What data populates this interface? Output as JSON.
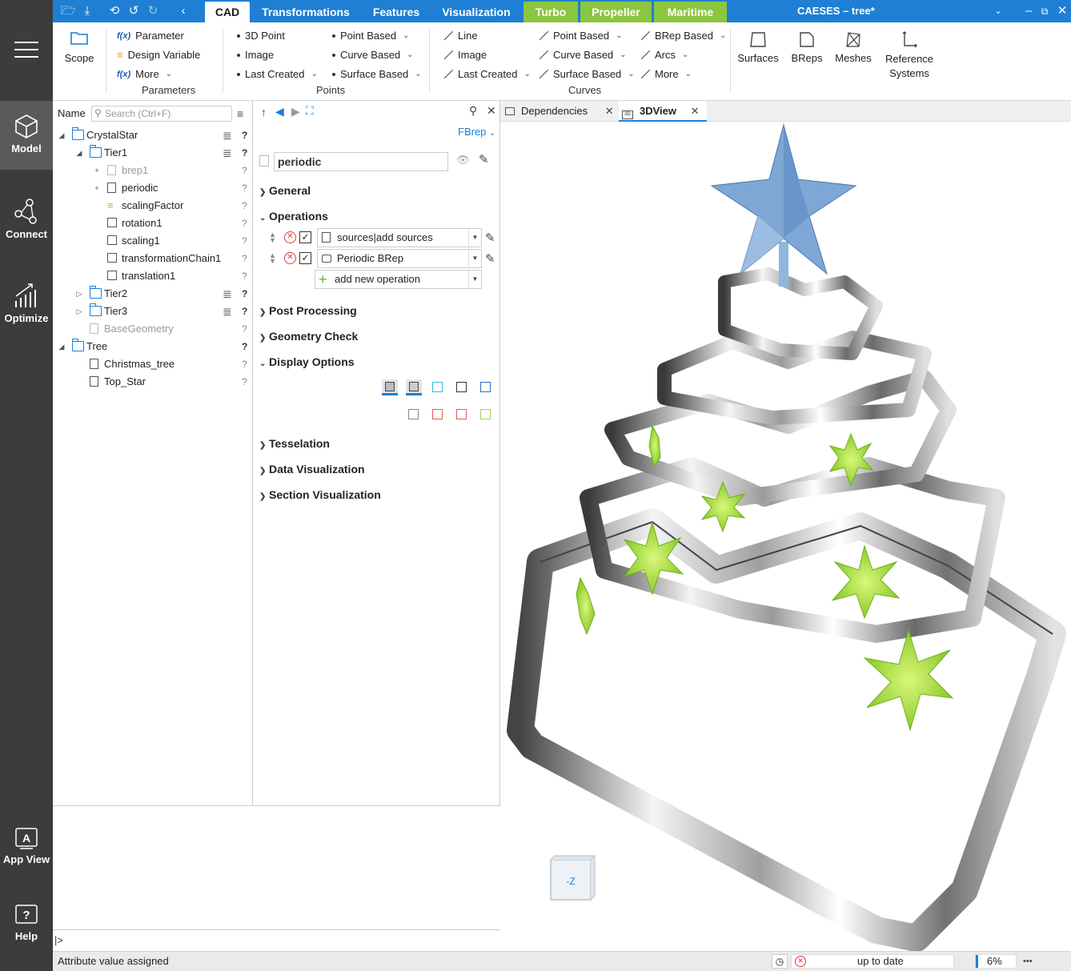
{
  "app": {
    "title": "CAESES  –  tree*",
    "accent": "#1e7fd4",
    "green": "#8cc63f"
  },
  "nav": [
    {
      "label": "Model",
      "icon": "cube-icon",
      "active": true
    },
    {
      "label": "Connect",
      "icon": "connect-icon"
    },
    {
      "label": "Optimize",
      "icon": "optimize-icon"
    },
    {
      "label": "App View",
      "icon": "app-view-icon"
    },
    {
      "label": "Help",
      "icon": "help-icon"
    }
  ],
  "tabs": {
    "items": [
      "CAD",
      "Transformations",
      "Features",
      "Visualization",
      "Turbo",
      "Propeller",
      "Maritime"
    ],
    "active": "CAD"
  },
  "ribbon": {
    "scope": "Scope",
    "parameters": {
      "items": [
        "Parameter",
        "Design Variable",
        "More"
      ],
      "label": "Parameters"
    },
    "points": {
      "col1": [
        "3D Point",
        "Image",
        "Last Created"
      ],
      "col2": [
        "Point Based",
        "Curve Based",
        "Surface Based"
      ],
      "label": "Points"
    },
    "curves": {
      "col1": [
        "Line",
        "Image",
        "Last Created"
      ],
      "col2": [
        "Point Based",
        "Curve Based",
        "Surface Based"
      ],
      "col3": [
        "BRep Based",
        "Arcs",
        "More"
      ],
      "label": "Curves"
    },
    "big": [
      "Surfaces",
      "BReps",
      "Meshes",
      "Reference Systems"
    ]
  },
  "tree": {
    "header": "Name",
    "search_placeholder": "Search (Ctrl+F)",
    "rows": [
      {
        "label": "CrystalStar",
        "q": "?"
      },
      {
        "label": "Tier1",
        "q": "?"
      },
      {
        "label": "brep1",
        "q": "?",
        "exp": "+"
      },
      {
        "label": "periodic",
        "q": "?",
        "exp": "+"
      },
      {
        "label": "scalingFactor",
        "q": "?"
      },
      {
        "label": "rotation1",
        "q": "?"
      },
      {
        "label": "scaling1",
        "q": "?"
      },
      {
        "label": "transformationChain1",
        "q": "?"
      },
      {
        "label": "translation1",
        "q": "?"
      },
      {
        "label": "Tier2",
        "q": "?"
      },
      {
        "label": "Tier3",
        "q": "?"
      },
      {
        "label": "BaseGeometry",
        "q": "?"
      },
      {
        "label": "Tree",
        "q": "?"
      },
      {
        "label": "Christmas_tree",
        "q": "?"
      },
      {
        "label": "Top_Star",
        "q": "?"
      }
    ]
  },
  "props": {
    "type": "FBrep",
    "name": "periodic",
    "sections": {
      "general": "General",
      "operations": "Operations",
      "post": "Post Processing",
      "geom": "Geometry Check",
      "display": "Display Options",
      "tess": "Tesselation",
      "datavis": "Data Visualization",
      "secvis": "Section Visualization"
    },
    "ops": [
      "sources|add sources",
      "Periodic BRep"
    ],
    "add_op": "add new operation"
  },
  "viewer": {
    "tabs": [
      "Dependencies",
      "3DView"
    ],
    "active": "3DView",
    "cube_label": "-Z"
  },
  "console": {
    "prompt": "|>"
  },
  "status": {
    "message": "Attribute value assigned",
    "state": "up to date",
    "zoom": "6%",
    "more": "•••"
  }
}
